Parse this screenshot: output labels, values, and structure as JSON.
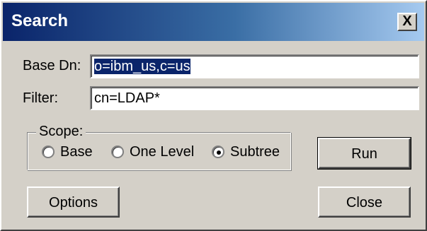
{
  "window": {
    "title": "Search",
    "close_label": "X"
  },
  "form": {
    "base_dn_label": "Base Dn:",
    "base_dn_value": "o=ibm_us,c=us",
    "filter_label": "Filter:",
    "filter_value": "cn=LDAP*"
  },
  "scope": {
    "legend": "Scope:",
    "options": [
      {
        "label": "Base",
        "selected": false
      },
      {
        "label": "One Level",
        "selected": false
      },
      {
        "label": "Subtree",
        "selected": true
      }
    ]
  },
  "buttons": {
    "run": "Run",
    "options": "Options",
    "close": "Close"
  }
}
